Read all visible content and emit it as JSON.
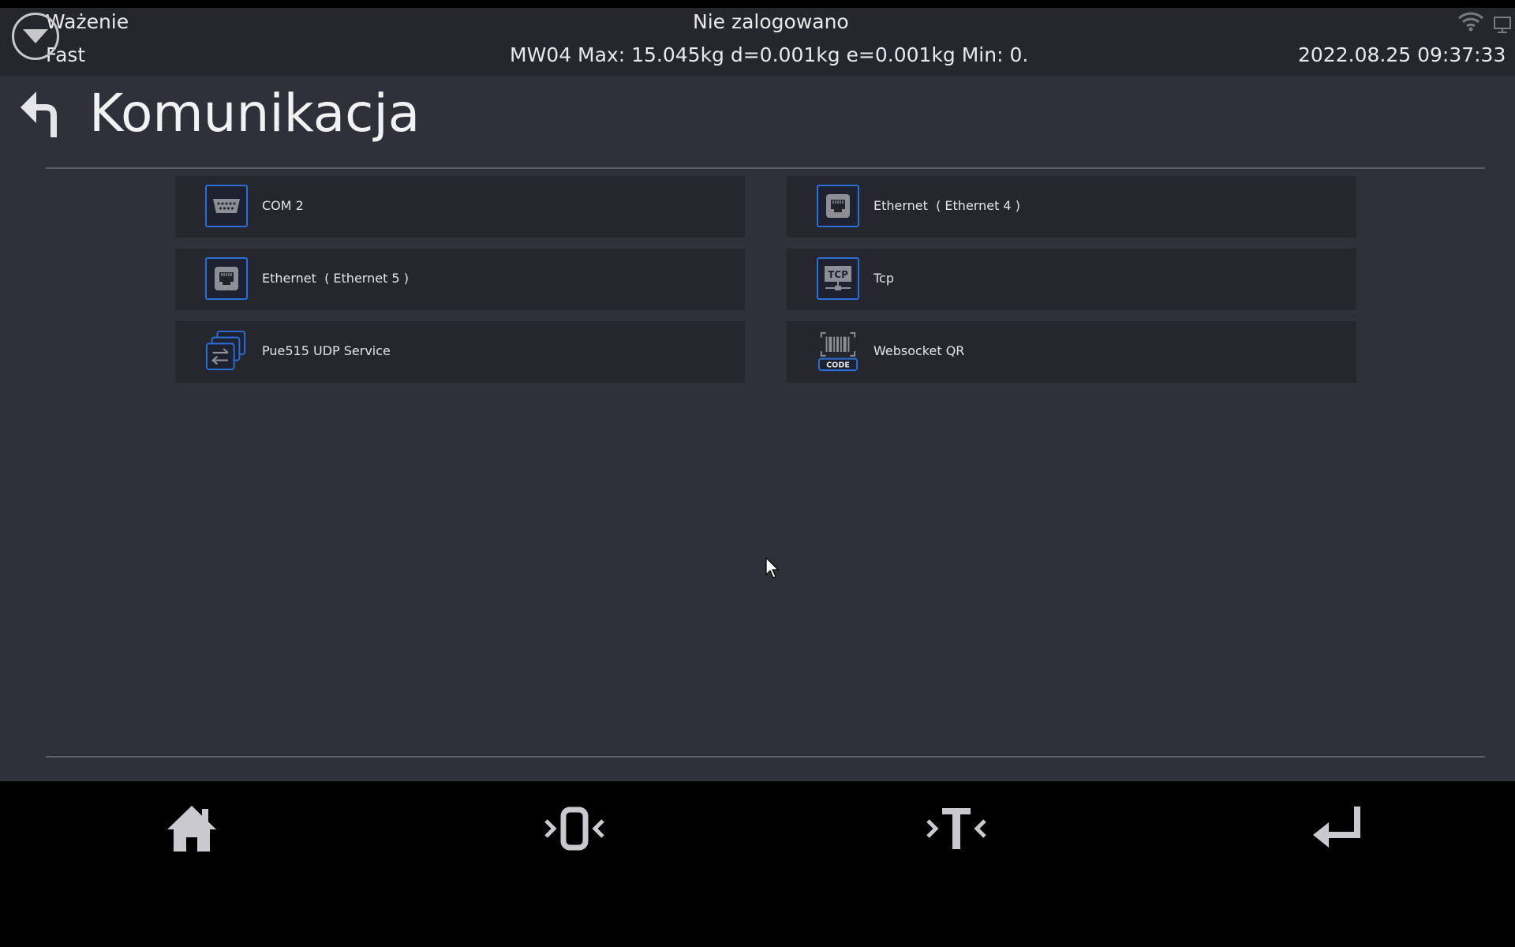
{
  "status_bar": {
    "mode": "Ważenie",
    "speed": "Fast",
    "login_status": "Nie zalogowano",
    "scale_info": "MW04 Max: 15.045kg d=0.001kg e=0.001kg  Min: 0.",
    "datetime": "2022.08.25 09:37:33"
  },
  "page": {
    "title": "Komunikacja"
  },
  "tiles": [
    {
      "label": "COM 2",
      "icon": "serial-port-icon"
    },
    {
      "label": "Ethernet  ( Ethernet 4 )",
      "icon": "ethernet-port-icon"
    },
    {
      "label": "Ethernet  ( Ethernet 5 )",
      "icon": "ethernet-port-icon"
    },
    {
      "label": "Tcp",
      "icon": "tcp-network-icon"
    },
    {
      "label": "Pue515 UDP Service",
      "icon": "udp-service-icon"
    },
    {
      "label": "Websocket QR",
      "icon": "barcode-qr-icon"
    }
  ],
  "tcp_icon_text": "TCP",
  "barcode_icon_text": "CODE",
  "colors": {
    "accent": "#2a6fd8",
    "background": "#30303a",
    "panel": "#26262e",
    "bottom_bar": "#000000"
  },
  "bottom_bar": {
    "buttons": [
      "home-icon",
      "zero-icon",
      "tare-icon",
      "enter-icon"
    ]
  }
}
